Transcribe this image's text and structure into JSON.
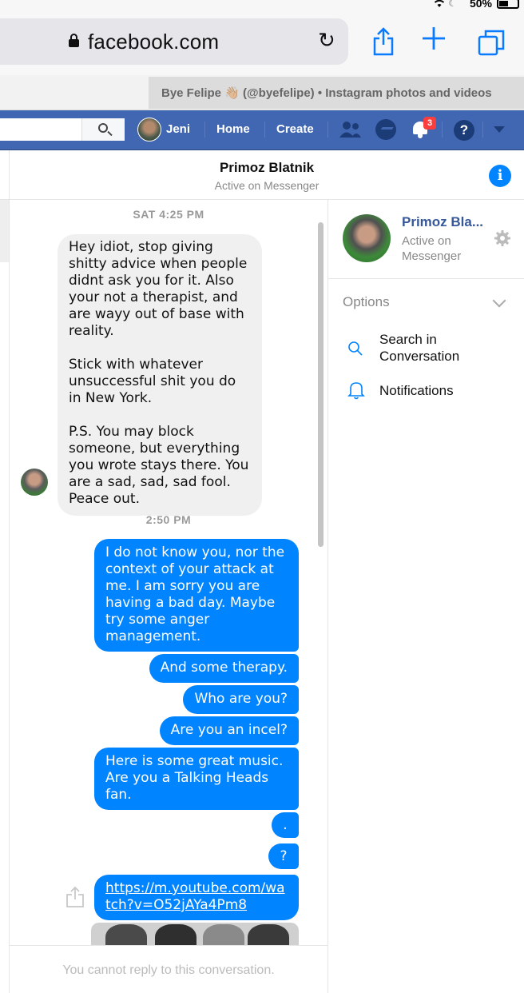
{
  "status_bar": {
    "battery_text": "50%"
  },
  "safari": {
    "url": "facebook.com",
    "tab_title": "Bye Felipe 👋🏼 (@byefelipe) • Instagram photos and videos"
  },
  "facebook_bar": {
    "user_name": "Jeni",
    "home_label": "Home",
    "create_label": "Create",
    "notification_count": "3",
    "help_label": "?"
  },
  "conversation": {
    "contact_name": "Primoz Blatnik",
    "contact_status": "Active on Messenger",
    "timestamp_1": "SAT 4:25 PM",
    "incoming_message": {
      "p1": "Hey idiot, stop giving shitty advice when people didnt ask you for it. Also your not a therapist, and are wayy out of base with reality.",
      "p2": "Stick with whatever unsuccessful shit  you do in New York.",
      "p3": "P.S. You may block someone, but everything you wrote stays there. You are a sad, sad, sad fool. Peace out."
    },
    "timestamp_2": "2:50 PM",
    "outgoing_messages": [
      "I do not know you, nor the context of your attack at me. I am sorry you are having a bad day. Maybe try some anger management.",
      "And some therapy.",
      "Who are you?",
      "Are you an incel?",
      "Here is some great music. Are you a Talking Heads fan.",
      ".",
      "?",
      "https://m.youtube.com/watch?v=O52jAYa4Pm8"
    ],
    "composer_notice": "You cannot reply to this conversation."
  },
  "right_panel": {
    "name": "Primoz Bla...",
    "status": "Active on Messenger",
    "options_label": "Options",
    "search_label": "Search in Conversation",
    "notifications_label": "Notifications"
  },
  "icons": {
    "status": [
      "wifi-icon",
      "moon-icon",
      "battery-icon"
    ],
    "safari": [
      "lock-icon",
      "reload-icon",
      "share-icon",
      "plus-icon",
      "tabs-icon"
    ],
    "facebook": [
      "search-icon",
      "friends-icon",
      "messenger-icon",
      "bell-icon",
      "help-icon",
      "caret-down-icon"
    ],
    "conversation": [
      "info-icon",
      "share-link-icon",
      "gear-icon",
      "chevron-down-icon",
      "search-icon",
      "bell-icon"
    ]
  },
  "colors": {
    "facebook_blue": "#4267b2",
    "messenger_blue": "#0084ff",
    "safari_blue": "#0a7aff",
    "incoming_bubble": "#f1f0f0",
    "badge_red": "#fa3e3e"
  }
}
